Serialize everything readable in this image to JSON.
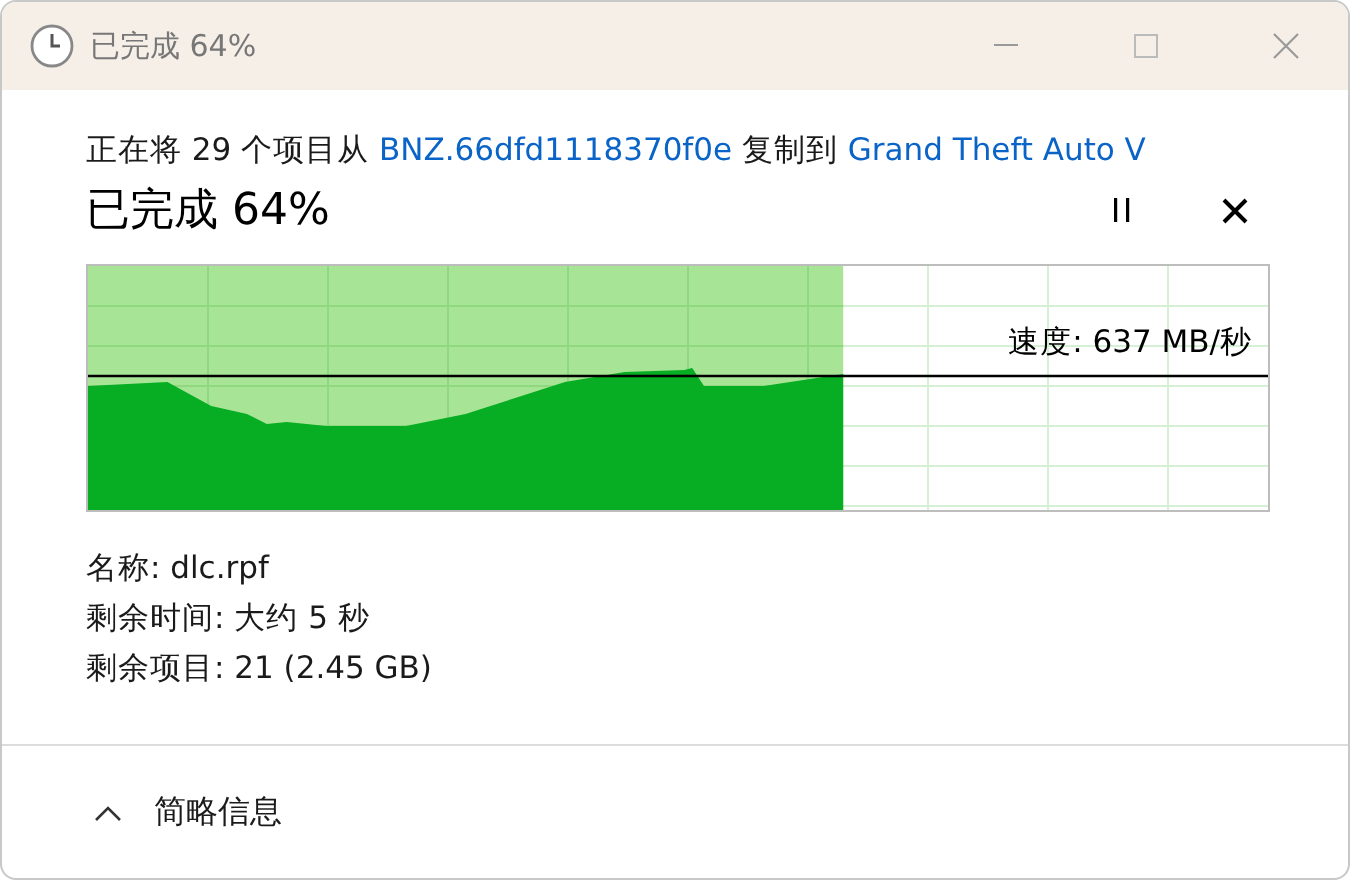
{
  "window": {
    "title": "已完成 64%"
  },
  "copy_status": [
    {
      "kind": "text",
      "text": "正在将 29 个项目从 "
    },
    {
      "kind": "link",
      "text": "BNZ.66dfd1118370f0e"
    },
    {
      "kind": "text",
      "text": " 复制到 "
    },
    {
      "kind": "link",
      "text": "Grand Theft Auto V"
    }
  ],
  "progress": {
    "heading": "已完成 64%",
    "level": 0.64,
    "speed": "速度: 637 MB/秒",
    "paused": false
  },
  "details": [
    "名称: dlc.rpf",
    "剩余时间: 大约 5 秒",
    "剩余项目: 21 (2.45 GB)"
  ],
  "footer": {
    "label": "简略信息",
    "expanded": true
  }
}
